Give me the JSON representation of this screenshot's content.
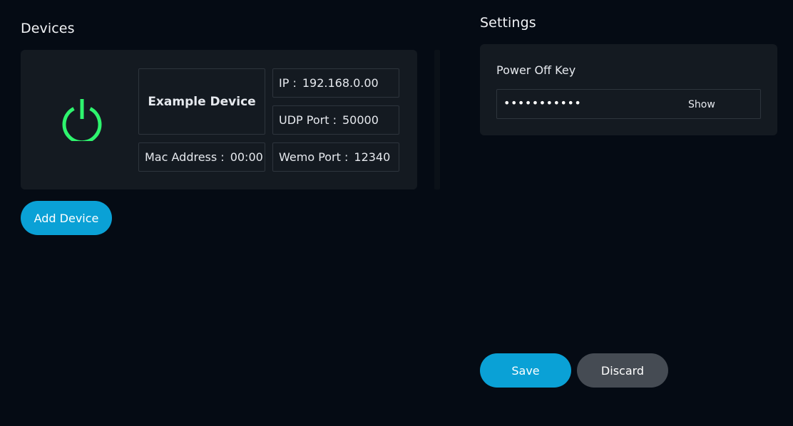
{
  "devices": {
    "title": "Devices",
    "items": [
      {
        "name": "Example Device",
        "ip_label": "IP :",
        "ip_value": "192.168.0.00",
        "udp_label": "UDP Port :",
        "udp_value": "50000",
        "mac_label": "Mac Address :",
        "mac_value": "00:00",
        "wemo_label": "Wemo Port :",
        "wemo_value": "12340",
        "power_icon": "power-icon",
        "power_color": "#2ef46e"
      }
    ],
    "add_button": "Add Device"
  },
  "settings": {
    "title": "Settings",
    "power_off_key_label": "Power Off Key",
    "power_off_key_value": "•••••••••••",
    "show_button": "Show"
  },
  "footer": {
    "save_label": "Save",
    "discard_label": "Discard"
  },
  "colors": {
    "background": "#050b14",
    "card": "#141a21",
    "accent": "#0aa1d6",
    "secondary_button": "#454b53",
    "power_on": "#2ef46e"
  }
}
